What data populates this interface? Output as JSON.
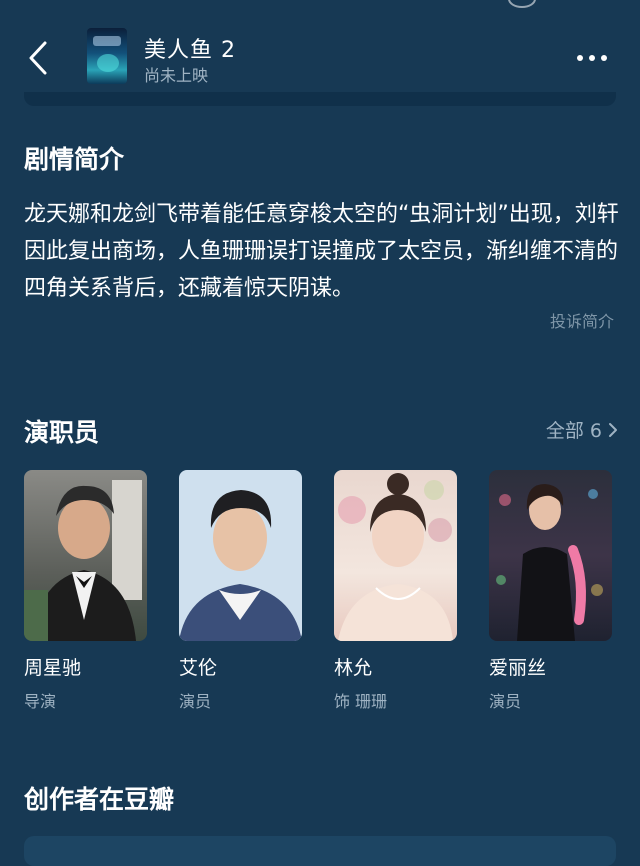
{
  "header": {
    "title": "美人鱼 2",
    "status": "尚未上映"
  },
  "synopsis": {
    "title": "剧情简介",
    "text": "龙天娜和龙剑飞带着能任意穿梭太空的“虫洞计划”出现，刘轩因此复出商场，人鱼珊珊误打误撞成了太空员，渐纠缠不清的四角关系背后，还藏着惊天阴谋。",
    "report_label": "投诉简介"
  },
  "cast": {
    "title": "演职员",
    "all_label": "全部 6",
    "members": [
      {
        "name": "周星驰",
        "role": "导演"
      },
      {
        "name": "艾伦",
        "role": "演员"
      },
      {
        "name": "林允",
        "role": "饰 珊珊"
      },
      {
        "name": "爱丽丝",
        "role": "演员"
      }
    ]
  },
  "creators": {
    "title": "创作者在豆瓣"
  },
  "colors": {
    "background": "#173954",
    "text_primary": "#ffffff",
    "text_secondary": "#9fb3c3"
  }
}
